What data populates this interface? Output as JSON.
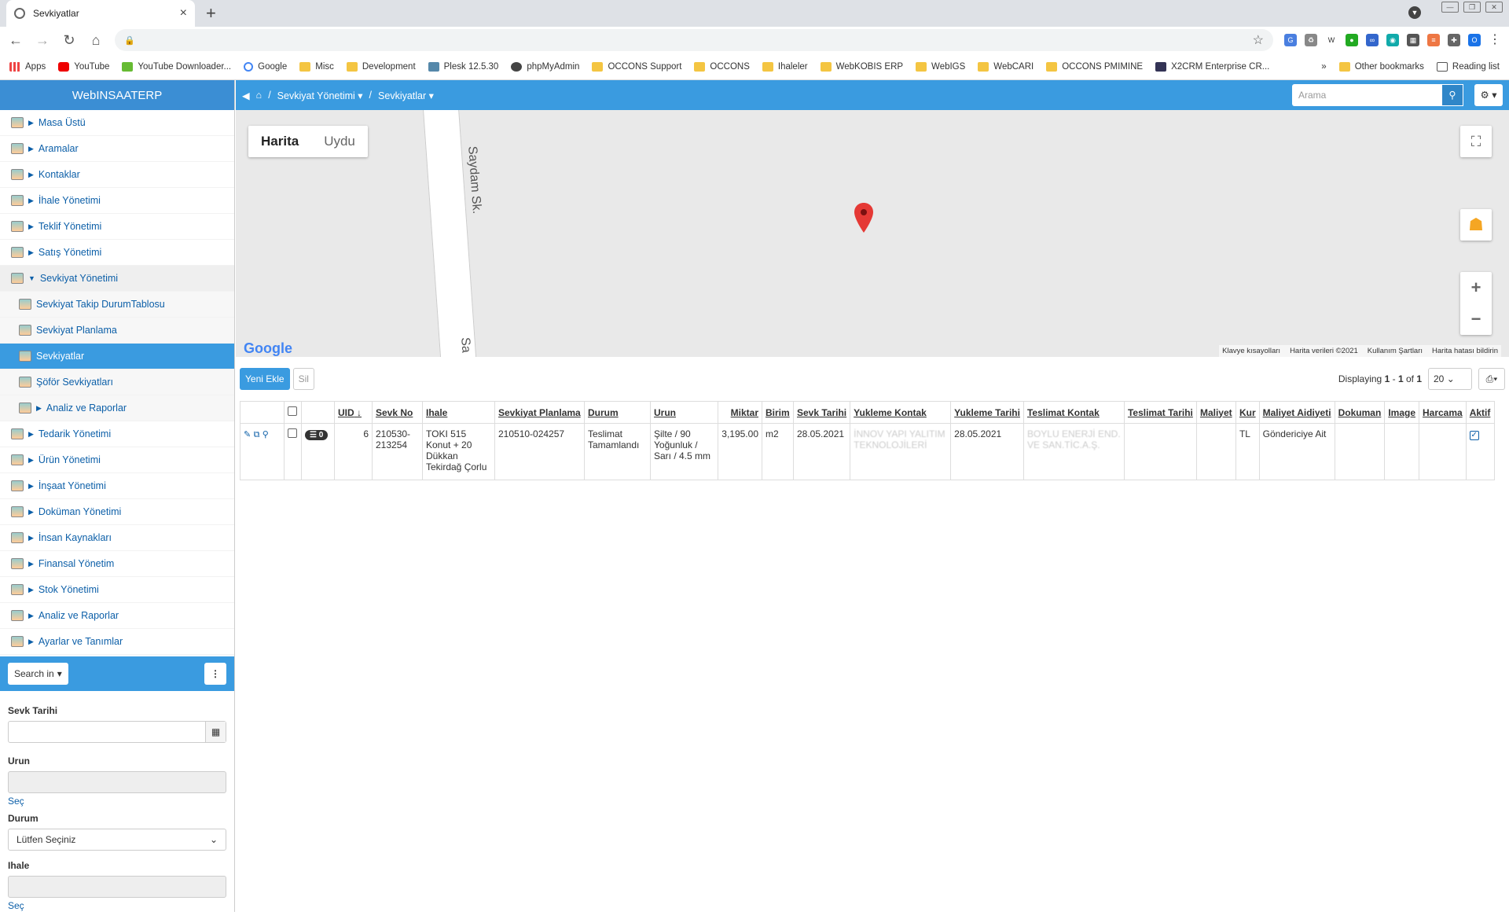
{
  "browser": {
    "tab_title": "Sevkiyatlar",
    "bookmarks": [
      "Apps",
      "YouTube",
      "YouTube Downloader...",
      "Google",
      "Misc",
      "Development",
      "Plesk 12.5.30",
      "phpMyAdmin",
      "OCCONS Support",
      "OCCONS",
      "Ihaleler",
      "WebKOBIS ERP",
      "WebIGS",
      "WebCARI",
      "OCCONS PMIMINE",
      "X2CRM Enterprise CR..."
    ],
    "bookmarks_more": "»",
    "other_bookmarks": "Other bookmarks",
    "reading_list": "Reading list",
    "profile_initial": "O"
  },
  "sidebar": {
    "brand": "WebINSAATERP",
    "items": [
      {
        "label": "Masa Üstü"
      },
      {
        "label": "Aramalar"
      },
      {
        "label": "Kontaklar"
      },
      {
        "label": "İhale Yönetimi"
      },
      {
        "label": "Teklif Yönetimi"
      },
      {
        "label": "Satış Yönetimi"
      },
      {
        "label": "Sevkiyat Yönetimi"
      },
      {
        "label": "Sevkiyat Takip DurumTablosu"
      },
      {
        "label": "Sevkiyat Planlama"
      },
      {
        "label": "Sevkiyatlar"
      },
      {
        "label": "Şöför Sevkiyatları"
      },
      {
        "label": "Analiz ve Raporlar"
      },
      {
        "label": "Tedarik Yönetimi"
      },
      {
        "label": "Ürün Yönetimi"
      },
      {
        "label": "İnşaat Yönetimi"
      },
      {
        "label": "Doküman Yönetimi"
      },
      {
        "label": "İnsan Kaynakları"
      },
      {
        "label": "Finansal Yönetim"
      },
      {
        "label": "Stok Yönetimi"
      },
      {
        "label": "Analiz ve Raporlar"
      },
      {
        "label": "Ayarlar ve Tanımlar"
      }
    ],
    "search_in": "Search in",
    "filters": {
      "sevk_tarihi_label": "Sevk Tarihi",
      "urun_label": "Urun",
      "sec1": "Seç",
      "durum_label": "Durum",
      "durum_value": "Lütfen Seçiniz",
      "ihale_label": "Ihale",
      "sec2": "Seç"
    }
  },
  "topbar": {
    "breadcrumb1": "Sevkiyat Yönetimi",
    "breadcrumb2": "Sevkiyatlar",
    "search_placeholder": "Arama"
  },
  "map": {
    "type_map": "Harita",
    "type_satellite": "Uydu",
    "road_name": "Saydam Sk.",
    "road_name_partial": "Sa",
    "google": "Google",
    "footer": [
      "Klavye kısayolları",
      "Harita verileri ©2021",
      "Kullanım Şartları",
      "Harita hatası bildirin"
    ]
  },
  "actions": {
    "add": "Yeni Ekle",
    "delete": "Sil",
    "displaying_prefix": "Displaying ",
    "range_from": "1",
    "range_sep": " - ",
    "range_to": "1",
    "of": " of ",
    "total": "1",
    "page_size": "20"
  },
  "table": {
    "headers": [
      "UID",
      "Sevk No",
      "Ihale",
      "Sevkiyat Planlama",
      "Durum",
      "Urun",
      "Miktar",
      "Birim",
      "Sevk Tarihi",
      "Yukleme Kontak",
      "Yukleme Tarihi",
      "Teslimat Kontak",
      "Teslimat Tarihi",
      "Maliyet",
      "Kur",
      "Maliyet Aidiyeti",
      "Dokuman",
      "Image",
      "Harcama",
      "Aktif"
    ],
    "sort_indicator": "↓",
    "rows": [
      {
        "badge": "0",
        "uid": "6",
        "sevk_no": "210530-213254",
        "ihale": "TOKI 515 Konut + 20 Dükkan Tekirdağ Çorlu",
        "planlama": "210510-024257",
        "durum": "Teslimat Tamamlandı",
        "urun": "Şilte / 90 Yoğunluk / Sarı / 4.5 mm",
        "miktar": "3,195.00",
        "birim": "m2",
        "sevk_tarihi": "28.05.2021",
        "yukleme_kontak": "İNNOV YAPI YALITIM TEKNOLOJİLERİ",
        "yukleme_tarihi": "28.05.2021",
        "teslimat_kontak": "BOYLU ENERJİ END. VE SAN.TİC.A.Ş.",
        "teslimat_tarihi": "",
        "maliyet": "",
        "kur": "TL",
        "maliyet_aidiyeti": "Göndericiye Ait",
        "dokuman": "",
        "image": "",
        "harcama": "",
        "aktif": true
      }
    ]
  }
}
